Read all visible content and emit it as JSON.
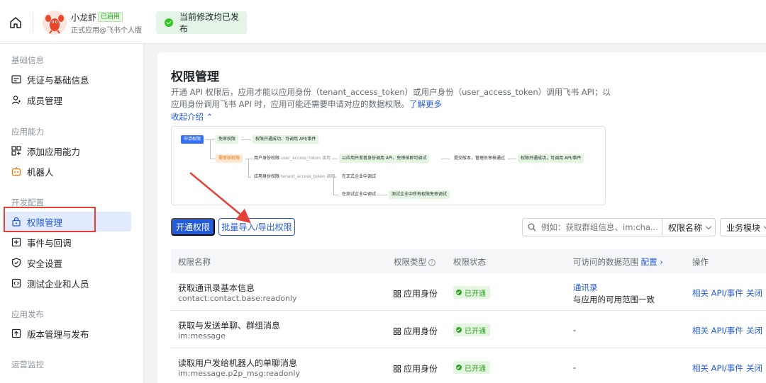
{
  "header": {
    "app_name": "小龙虾",
    "app_badge": "已启用",
    "app_subtitle": "正式应用@飞书个人版",
    "publish_status": "当前修改均已发布"
  },
  "sidebar": {
    "sections": [
      {
        "title": "基础信息",
        "items": [
          {
            "label": "凭证与基础信息",
            "icon": "id-card-icon"
          },
          {
            "label": "成员管理",
            "icon": "user-icon"
          }
        ]
      },
      {
        "title": "应用能力",
        "items": [
          {
            "label": "添加应用能力",
            "icon": "grid-plus-icon"
          },
          {
            "label": "机器人",
            "icon": "robot-icon"
          }
        ]
      },
      {
        "title": "开发配置",
        "items": [
          {
            "label": "权限管理",
            "icon": "lock-icon"
          },
          {
            "label": "事件与回调",
            "icon": "plus-square-icon"
          },
          {
            "label": "安全设置",
            "icon": "shield-icon"
          },
          {
            "label": "测试企业和人员",
            "icon": "code-icon"
          }
        ]
      },
      {
        "title": "应用发布",
        "items": [
          {
            "label": "版本管理与发布",
            "icon": "upload-icon"
          }
        ]
      },
      {
        "title": "运营监控",
        "items": []
      }
    ],
    "active_item": "权限管理"
  },
  "main": {
    "title": "权限管理",
    "description": "开通 API 权限后，应用才能以应用身份（tenant_access_token）或用户身份（user_access_token）调用飞书 API；以应用身份调用飞书 API 时，应用可能还需要申请对应的数据权限。",
    "learn_more": "了解更多",
    "collapse_intro": "收起介绍",
    "flow": {
      "apply": "申请权限",
      "no_review": "免审权限",
      "no_review_result": "权限开通成功，可调用 API/事件",
      "need_review": "需审核权限",
      "user_identity": "用户身份权限",
      "user_token": "user_access_token",
      "call": "调用",
      "dev_call": "以应用开发者身份调用 API，免审核即可调试",
      "submit_version": "提交版本，管理员审核通过",
      "review_result": "权限开通成功，可调用 API/事件",
      "app_identity": "应用身份权限",
      "tenant_token": "tenant_access_token",
      "call2": "调用",
      "formal_debug": "在正式企业中调试",
      "test_debug": "在测试企业中调试",
      "test_result": "测试企业中所有权限免审调试"
    },
    "buttons": {
      "open_permission": "开通权限",
      "batch": "批量导入/导出权限"
    },
    "search": {
      "placeholder": "例如：获取群组信息、im:cha..."
    },
    "filter_a": "权限名称",
    "filter_b": "业务模块",
    "table": {
      "columns": [
        "权限名称",
        "权限类型",
        "权限状态",
        "可访问的数据范围",
        "操作"
      ],
      "config": "配置",
      "rows": [
        {
          "name": "获取通讯录基本信息",
          "code": "contact:contact.base:readonly",
          "type": "应用身份",
          "status": "已开通",
          "scope_link": "通讯录",
          "scope_text": "与应用的可用范围一致",
          "op1": "相关 API/事件",
          "op2": "关闭"
        },
        {
          "name": "获取与发送单聊、群组消息",
          "code": "im:message",
          "type": "应用身份",
          "status": "已开通",
          "scope_link": "",
          "scope_text": "-",
          "op1": "相关 API/事件",
          "op2": "关闭"
        },
        {
          "name": "读取用户发给机器人的单聊消息",
          "code": "im:message.p2p_msg:readonly",
          "type": "应用身份",
          "status": "已开通",
          "scope_link": "",
          "scope_text": "-",
          "op1": "相关 API/事件",
          "op2": "关闭"
        }
      ]
    }
  },
  "colors": {
    "accent": "#245bdb",
    "success": "#2ea121",
    "annotation": "#e4413a"
  }
}
